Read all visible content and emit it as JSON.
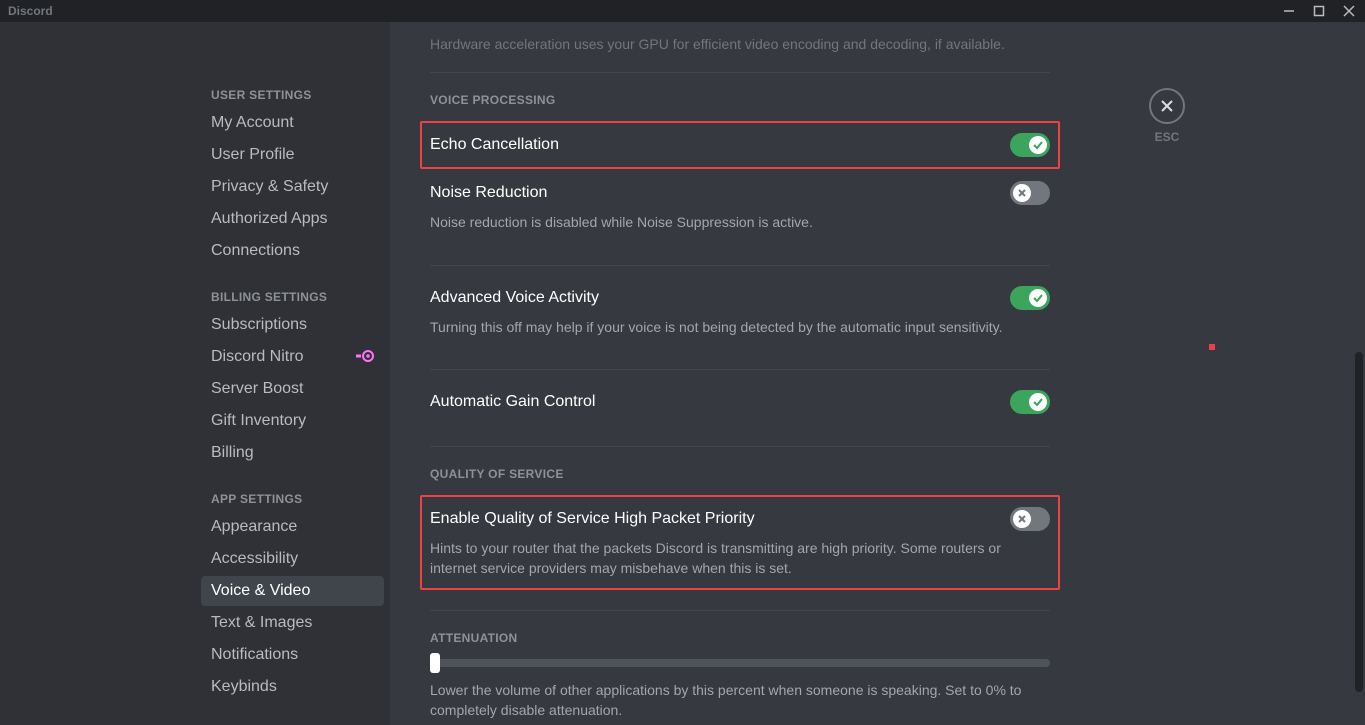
{
  "titlebar": {
    "app_name": "Discord"
  },
  "close": {
    "esc": "ESC"
  },
  "sidebar": {
    "sections": [
      {
        "header": "USER SETTINGS",
        "items": [
          {
            "label": "My Account"
          },
          {
            "label": "User Profile"
          },
          {
            "label": "Privacy & Safety"
          },
          {
            "label": "Authorized Apps"
          },
          {
            "label": "Connections"
          }
        ]
      },
      {
        "header": "BILLING SETTINGS",
        "items": [
          {
            "label": "Subscriptions"
          },
          {
            "label": "Discord Nitro"
          },
          {
            "label": "Server Boost"
          },
          {
            "label": "Gift Inventory"
          },
          {
            "label": "Billing"
          }
        ]
      },
      {
        "header": "APP SETTINGS",
        "items": [
          {
            "label": "Appearance"
          },
          {
            "label": "Accessibility"
          },
          {
            "label": "Voice & Video"
          },
          {
            "label": "Text & Images"
          },
          {
            "label": "Notifications"
          },
          {
            "label": "Keybinds"
          }
        ]
      }
    ]
  },
  "content": {
    "prev_line": "Hardware acceleration uses your GPU for efficient video encoding and decoding, if available.",
    "sections": {
      "voice_processing": {
        "title": "VOICE PROCESSING",
        "echo": {
          "label": "Echo Cancellation"
        },
        "noise": {
          "label": "Noise Reduction",
          "desc": "Noise reduction is disabled while Noise Suppression is active."
        },
        "advanced": {
          "label": "Advanced Voice Activity",
          "desc": "Turning this off may help if your voice is not being detected by the automatic input sensitivity."
        },
        "agc": {
          "label": "Automatic Gain Control"
        }
      },
      "qos": {
        "title": "QUALITY OF SERVICE",
        "enable": {
          "label": "Enable Quality of Service High Packet Priority",
          "desc": "Hints to your router that the packets Discord is transmitting are high priority. Some routers or internet service providers may misbehave when this is set."
        }
      },
      "attenuation": {
        "title": "ATTENUATION",
        "desc": "Lower the volume of other applications by this percent when someone is speaking. Set to 0% to completely disable attenuation."
      }
    }
  }
}
